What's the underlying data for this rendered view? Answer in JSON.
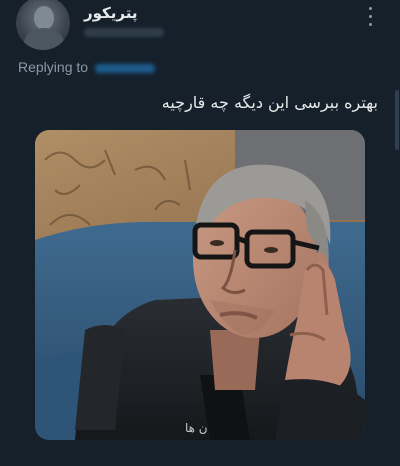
{
  "tweet": {
    "display_name": "پتریکور",
    "replying_label": "Replying to",
    "text": "بهتره ببرسی این دیگه چه قارچیه",
    "media_alt_chars": "ن ها"
  },
  "icons": {
    "more": "more-vertical-icon",
    "avatar": "avatar"
  },
  "colors": {
    "background": "#15202b",
    "text": "#e7e9ea",
    "secondary": "#8b98a5",
    "link": "#1d9bf0"
  }
}
